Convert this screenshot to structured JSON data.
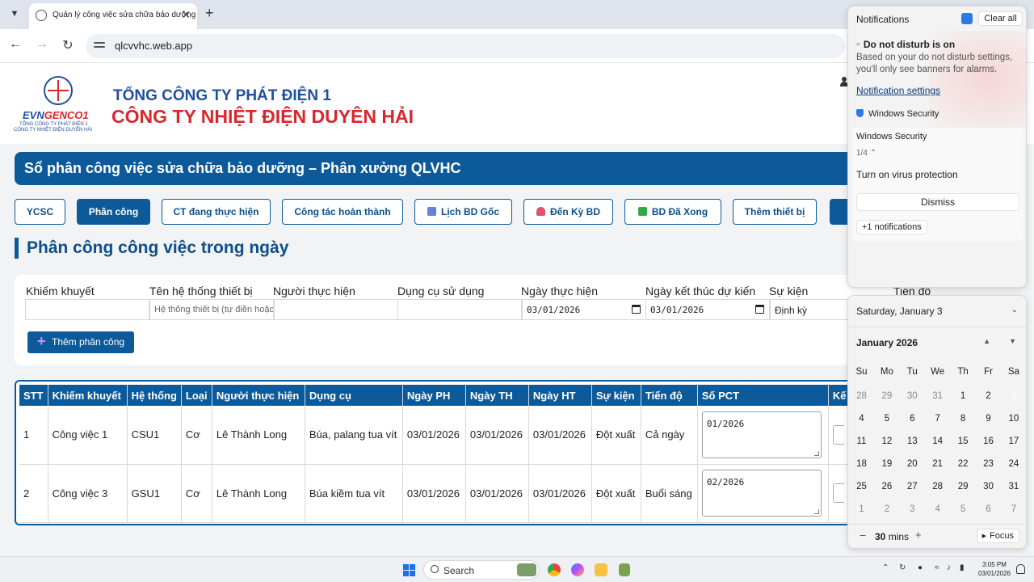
{
  "browser": {
    "tab_title": "Quản lý công việc sửa chữa bảo dưỡng",
    "url": "qlcvvhc.web.app"
  },
  "header": {
    "logo_brand_a": "EVN",
    "logo_brand_b": "GENCO1",
    "logo_sub1": "TỔNG CÔNG TY PHÁT ĐIỆN 1",
    "logo_sub2": "CÔNG TY NHIỆT ĐIỆN DUYÊN HẢI",
    "org_line1": "TỔNG CÔNG TY PHÁT ĐIỆN 1",
    "org_line2": "CÔNG TY NHIỆT ĐIỆN DUYÊN HẢI"
  },
  "banner": "Sổ phân công việc sửa chữa bảo dưỡng – Phân xưởng QLVHC",
  "nav": {
    "items": [
      {
        "label": "YCSC"
      },
      {
        "label": "Phân công"
      },
      {
        "label": "CT đang thực hiện"
      },
      {
        "label": "Công tác hoàn thành"
      },
      {
        "label": "Lịch BD Gốc"
      },
      {
        "label": "Đến Kỳ BD"
      },
      {
        "label": "BD Đã Xong"
      },
      {
        "label": "Thêm thiết bị"
      }
    ],
    "icon_colors": [
      "#6a7fd6",
      "#e0556b",
      "#2faa4b"
    ]
  },
  "section_title": "Phân công công việc trong ngày",
  "form": {
    "labels": [
      "Khiếm khuyết",
      "Tên hệ thống thiết bị",
      "Người thực hiện",
      "Dụng cụ sử dụng",
      "Ngày thực hiện",
      "Ngày kết thúc dự kiến",
      "Sự kiện",
      "Tiến độ"
    ],
    "system_placeholder": "Hệ thống thiết bị (tự điền hoặc chọn)",
    "start_date": "03/01/2026",
    "end_date": "03/01/2026",
    "event_value": "Định kỳ",
    "add_button": "Thêm phân công"
  },
  "table": {
    "headers": [
      "STT",
      "Khiếm khuyết",
      "Hệ thống",
      "Loại",
      "Người thực hiện",
      "Dụng cụ",
      "Ngày PH",
      "Ngày TH",
      "Ngày HT",
      "Sự kiện",
      "Tiến độ",
      "Số PCT",
      "Kế"
    ],
    "rows": [
      [
        "1",
        "Công việc 1",
        "CSU1",
        "Cơ",
        "Lê Thành Long",
        "Búa, palang tua vít",
        "03/01/2026",
        "03/01/2026",
        "03/01/2026",
        "Đột xuất",
        "Cả ngày",
        "01/2026"
      ],
      [
        "2",
        "Công việc 3",
        "GSU1",
        "Cơ",
        "Lê Thành Long",
        "Búa kiềm tua vít",
        "03/01/2026",
        "03/01/2026",
        "03/01/2026",
        "Đột xuất",
        "Buổi sáng",
        "02/2026"
      ]
    ]
  },
  "notifications": {
    "title": "Notifications",
    "clear_all": "Clear all",
    "dnd_title": "Do not disturb is on",
    "dnd_text": "Based on your do not disturb settings, you'll only see banners for alarms.",
    "settings_link": "Notification settings",
    "app_name": "Windows Security",
    "card_header": "Windows Security",
    "count": "1/4",
    "message": "Turn on virus protection",
    "dismiss": "Dismiss",
    "more": "+1 notifications"
  },
  "calendar": {
    "date_header": "Saturday, January 3",
    "month": "January 2026",
    "weekdays": [
      "Su",
      "Mo",
      "Tu",
      "We",
      "Th",
      "Fr",
      "Sa"
    ],
    "days": [
      [
        "28",
        "29",
        "30",
        "31",
        "1",
        "2",
        "3"
      ],
      [
        "4",
        "5",
        "6",
        "7",
        "8",
        "9",
        "10"
      ],
      [
        "11",
        "12",
        "13",
        "14",
        "15",
        "16",
        "17"
      ],
      [
        "18",
        "19",
        "20",
        "21",
        "22",
        "23",
        "24"
      ],
      [
        "25",
        "26",
        "27",
        "28",
        "29",
        "30",
        "31"
      ],
      [
        "1",
        "2",
        "3",
        "4",
        "5",
        "6",
        "7"
      ]
    ],
    "focus_minutes": "30",
    "minutes_unit": "mins",
    "focus_button": "Focus"
  },
  "taskbar": {
    "search": "Search",
    "time": "3:05 PM",
    "date": "03/01/2026"
  },
  "colors": {
    "primary": "#0d5a9a",
    "accent_red": "#d9262c",
    "today": "#1f5fb4"
  }
}
